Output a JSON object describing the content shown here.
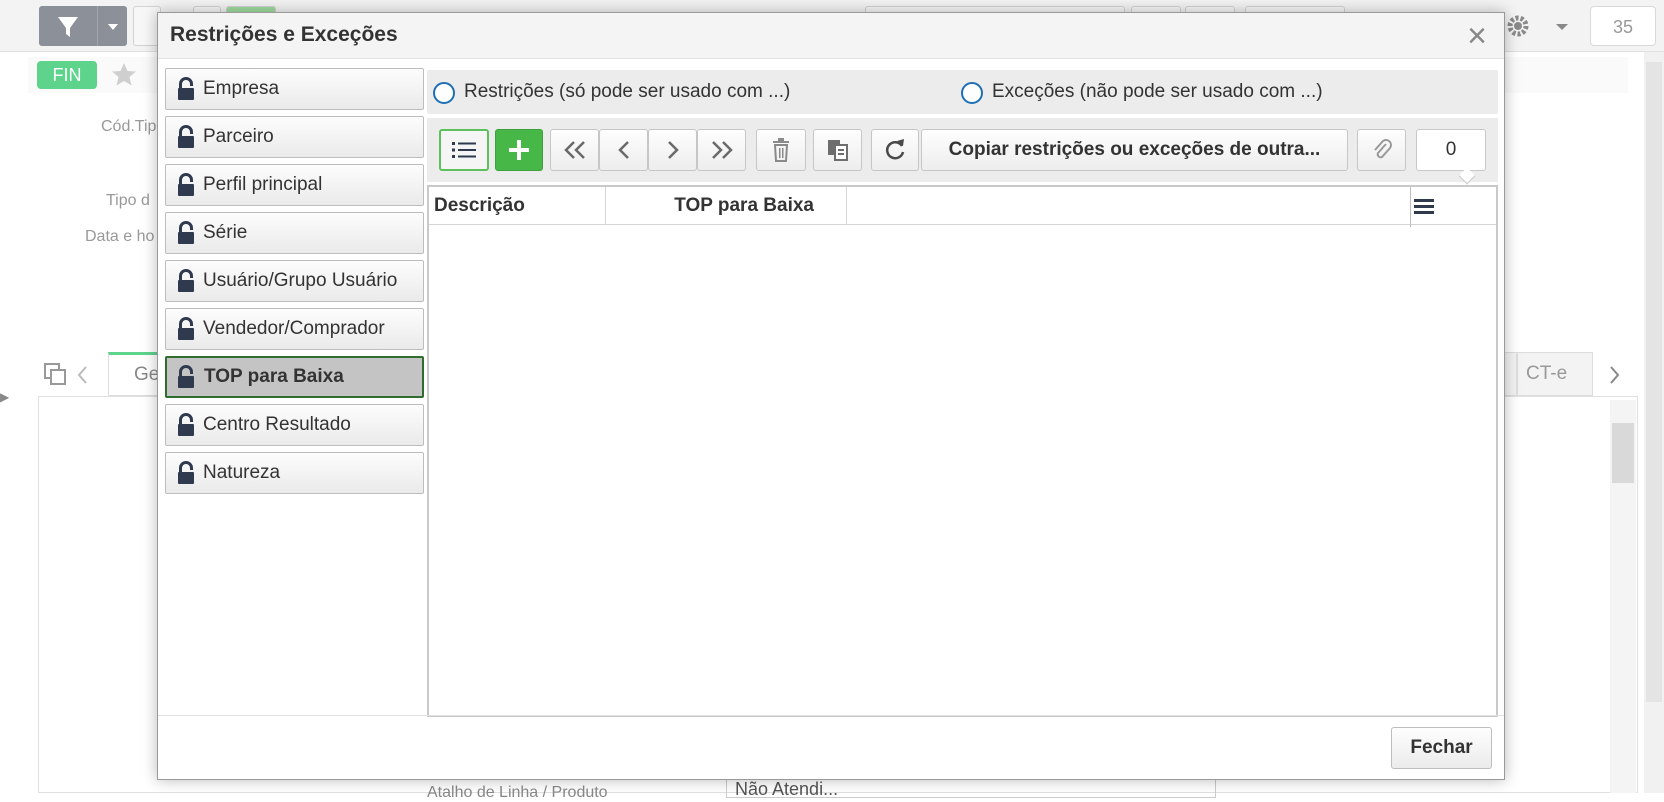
{
  "background": {
    "counter": "35",
    "badge": "FIN",
    "labels": [
      "Cód.Tip",
      "Tipo d",
      "Data e ho"
    ],
    "tab_partial": "Ge",
    "tab_right": "CT-e",
    "row_bottom_left": "Atalho de Linha / Produto",
    "row_bottom_right": "Não Atendi..."
  },
  "modal": {
    "title": "Restrições e Exceções",
    "sidebar": [
      {
        "label": "Empresa",
        "active": false
      },
      {
        "label": "Parceiro",
        "active": false
      },
      {
        "label": "Perfil principal",
        "active": false
      },
      {
        "label": "Série",
        "active": false
      },
      {
        "label": "Usuário/Grupo Usuário",
        "active": false
      },
      {
        "label": "Vendedor/Comprador",
        "active": false
      },
      {
        "label": "TOP para Baixa",
        "active": true
      },
      {
        "label": "Centro Resultado",
        "active": false
      },
      {
        "label": "Natureza",
        "active": false
      }
    ],
    "radios": {
      "restricoes": "Restrições (só pode ser usado com ...)",
      "excecoes": "Exceções (não pode ser usado com ...)"
    },
    "toolbar": {
      "copy_label": "Copiar restrições ou exceções de outra...",
      "attachment_count": "0"
    },
    "grid": {
      "columns": [
        "Descrição",
        "TOP para Baixa"
      ]
    },
    "close_button": "Fechar"
  },
  "colors": {
    "add_button": "#47b747",
    "active_border": "#2f6d2f",
    "radio": "#1f6fb5",
    "badge": "#5ed38b"
  }
}
